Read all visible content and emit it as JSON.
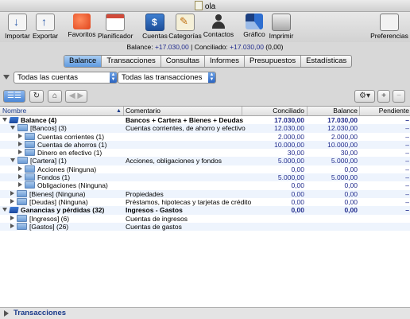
{
  "window": {
    "title": "ola"
  },
  "toolbar": {
    "items": [
      {
        "label": "Importar",
        "icon": "import-icon"
      },
      {
        "label": "Exportar",
        "icon": "export-icon"
      },
      {
        "label": "Favoritos",
        "icon": "favorites-icon"
      },
      {
        "label": "Planificador",
        "icon": "calendar-icon"
      },
      {
        "label": "Cuentas",
        "icon": "accounts-icon"
      },
      {
        "label": "Categorías",
        "icon": "categories-icon"
      },
      {
        "label": "Contactos",
        "icon": "contacts-icon"
      },
      {
        "label": "Gráfico",
        "icon": "chart-icon"
      },
      {
        "label": "Imprimir",
        "icon": "printer-icon"
      },
      {
        "label": "Preferencias",
        "icon": "preferences-icon"
      }
    ]
  },
  "status": {
    "balance_label": "Balance:",
    "balance_value": "+17.030,00",
    "separator": "|",
    "reconciled_label": "Conciliado:",
    "reconciled_value": "+17.030,00",
    "pending_value": "(0,00)"
  },
  "tabs": [
    "Balance",
    "Transacciones",
    "Consultas",
    "Informes",
    "Presupuestos",
    "Estadísticas"
  ],
  "active_tab": "Balance",
  "filters": {
    "accounts": "Todas las cuentas",
    "transactions": "Todas las transacciones"
  },
  "table": {
    "headers": {
      "name": "Nombre",
      "comment": "Comentario",
      "reconciled": "Conciliado",
      "balance": "Balance",
      "pending": "Pendiente"
    },
    "rows": [
      {
        "level": 0,
        "state": "open",
        "icon": "book",
        "bold": true,
        "name": "Balance (4)",
        "comment": "Bancos + Cartera + Bienes + Deudas",
        "reconciled": "17.030,00",
        "balance": "17.030,00",
        "pending": "–"
      },
      {
        "level": 1,
        "state": "open",
        "icon": "folder",
        "bold": false,
        "name": "[Bancos] (3)",
        "comment": "Cuentas corrientes, de ahorro y efectivo",
        "reconciled": "12.030,00",
        "balance": "12.030,00",
        "pending": "–"
      },
      {
        "level": 2,
        "state": "closed",
        "icon": "folder",
        "bold": false,
        "name": "Cuentas corrientes (1)",
        "comment": "",
        "reconciled": "2.000,00",
        "balance": "2.000,00",
        "pending": "–"
      },
      {
        "level": 2,
        "state": "closed",
        "icon": "folder",
        "bold": false,
        "name": "Cuentas de ahorros (1)",
        "comment": "",
        "reconciled": "10.000,00",
        "balance": "10.000,00",
        "pending": "–"
      },
      {
        "level": 2,
        "state": "closed",
        "icon": "folder",
        "bold": false,
        "name": "Dinero en efectivo (1)",
        "comment": "",
        "reconciled": "30,00",
        "balance": "30,00",
        "pending": "–"
      },
      {
        "level": 1,
        "state": "open",
        "icon": "folder",
        "bold": false,
        "name": "[Cartera] (1)",
        "comment": "Acciones, obligaciones y fondos",
        "reconciled": "5.000,00",
        "balance": "5.000,00",
        "pending": "–"
      },
      {
        "level": 2,
        "state": "closed",
        "icon": "folder",
        "bold": false,
        "name": "Acciones (Ninguna)",
        "comment": "",
        "reconciled": "0,00",
        "balance": "0,00",
        "pending": "–"
      },
      {
        "level": 2,
        "state": "closed",
        "icon": "folder",
        "bold": false,
        "name": "Fondos (1)",
        "comment": "",
        "reconciled": "5.000,00",
        "balance": "5.000,00",
        "pending": "–"
      },
      {
        "level": 2,
        "state": "closed",
        "icon": "folder",
        "bold": false,
        "name": "Obligaciones (Ninguna)",
        "comment": "",
        "reconciled": "0,00",
        "balance": "0,00",
        "pending": "–"
      },
      {
        "level": 1,
        "state": "closed",
        "icon": "folder",
        "bold": false,
        "name": "[Bienes] (Ninguna)",
        "comment": "Propiedades",
        "reconciled": "0,00",
        "balance": "0,00",
        "pending": "–"
      },
      {
        "level": 1,
        "state": "closed",
        "icon": "folder",
        "bold": false,
        "name": "[Deudas] (Ninguna)",
        "comment": "Préstamos, hipotecas y tarjetas de crédito",
        "reconciled": "0,00",
        "balance": "0,00",
        "pending": "–"
      },
      {
        "level": 0,
        "state": "open",
        "icon": "book",
        "bold": true,
        "name": "Ganancias y pérdidas (32)",
        "comment": "Ingresos - Gastos",
        "reconciled": "0,00",
        "balance": "0,00",
        "pending": "–"
      },
      {
        "level": 1,
        "state": "closed",
        "icon": "folder",
        "bold": false,
        "name": "[Ingresos] (6)",
        "comment": "Cuentas de ingresos",
        "reconciled": "",
        "balance": "",
        "pending": ""
      },
      {
        "level": 1,
        "state": "closed",
        "icon": "folder",
        "bold": false,
        "name": "[Gastos] (26)",
        "comment": "Cuentas de gastos",
        "reconciled": "",
        "balance": "",
        "pending": ""
      }
    ]
  },
  "footer": {
    "label": "Transacciones"
  }
}
